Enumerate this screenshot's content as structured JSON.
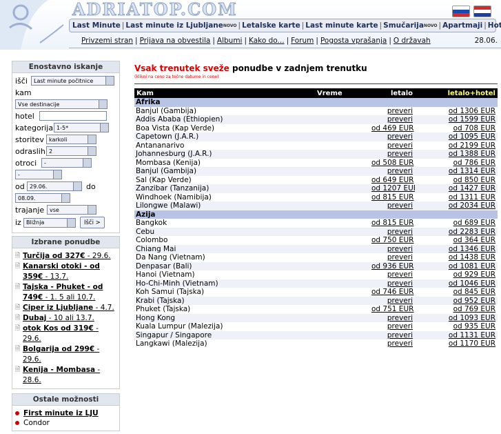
{
  "logo": "ADRIATOP.COM",
  "nav_primary": [
    {
      "label": "Last Minute",
      "sup": ""
    },
    {
      "label": "Last minute iz Ljubljane",
      "sup": "NOVO"
    },
    {
      "label": "Letalske karte",
      "sup": ""
    },
    {
      "label": "Last minute karte",
      "sup": ""
    },
    {
      "label": "Smučarija",
      "sup": "NOVO"
    },
    {
      "label": "Apartmaji",
      "sup": ""
    },
    {
      "label": "Hoteli",
      "sup": ""
    }
  ],
  "nav_secondary": [
    "Privzemi stran",
    "Prijava na obvestila",
    "Albumi",
    "Kako do...",
    "Forum",
    "Pogosta vprašanja",
    "O državah"
  ],
  "date": "28.06.",
  "search": {
    "title": "Enostavno iskanje",
    "isci_label": "išči",
    "isci_value": "Last minute počitnice",
    "kam_label": "kam",
    "kam_value": "Vse destinacije",
    "hotel_label": "hotel",
    "kategorija_label": "kategorija",
    "kategorija_value": "1-5*",
    "storitev_label": "storitev",
    "storitev_value": "karkoli",
    "odraslih_label": "odraslih",
    "odraslih_value": "2",
    "otroci_label": "otroci",
    "otroci_value": "-",
    "extra_value": "-",
    "od_label": "od",
    "od_value": "29.06.",
    "do_label": "do",
    "do_value": "08.09.",
    "trajanje_label": "trajanje",
    "trajanje_value": "vse",
    "iz_label": "iz",
    "iz_value": "Bližnja",
    "button": "Išči >"
  },
  "featured": {
    "title": "Izbrane ponudbe",
    "items": [
      {
        "bold": "Turčija od 327€",
        "rest": " - 29.6."
      },
      {
        "bold": "Kanarski otoki - od 359€",
        "rest": " - 13.7."
      },
      {
        "bold": "Tajska - Phuket - od 749€",
        "rest": " - 1. 5 ali 10.7."
      },
      {
        "bold": "Ciper iz Ljubljane",
        "rest": " - 4.7."
      },
      {
        "bold": "Dubaj",
        "rest": " - 10 ali 13.7."
      },
      {
        "bold": "otok Kos od 319€",
        "rest": " - 29.6."
      },
      {
        "bold": "Bolgarija od 299€",
        "rest": " - 29.6."
      },
      {
        "bold": "Kenija - Mombasa",
        "rest": " - 28.6."
      }
    ]
  },
  "other": {
    "title": "Ostale možnosti",
    "items": [
      {
        "label": "First minute iz LJU",
        "bold": true
      },
      {
        "label": "Condor",
        "bold": false
      }
    ]
  },
  "main": {
    "title_red": "Vsak trenutek sveže",
    "title_rest": " ponudbe v zadnjem trenutku",
    "subtitle": "(klikni na ceno za točne datume in cene)",
    "columns": [
      "Kam",
      "Vreme",
      "letalo",
      "letalo+hotel"
    ],
    "groups": [
      {
        "name": "Afrika",
        "rows": [
          {
            "kam": "Banjul (Gambija)",
            "letalo": "preveri",
            "hotel": "od 1306 EUR"
          },
          {
            "kam": "Addis Ababa (Ethiopien)",
            "letalo": "preveri",
            "hotel": "od 1599 EUR"
          },
          {
            "kam": "Boa Vista (Kap Verde)",
            "letalo": "od 469 EUR",
            "hotel": "od 708 EUR"
          },
          {
            "kam": "Capetown (J.A.R.)",
            "letalo": "preveri",
            "hotel": "od 1095 EUR"
          },
          {
            "kam": "Antananarivo",
            "letalo": "preveri",
            "hotel": "od 2199 EUR"
          },
          {
            "kam": "Johannesburg (J.A.R.)",
            "letalo": "preveri",
            "hotel": "od 1388 EUR"
          },
          {
            "kam": "Mombasa (Kenija)",
            "letalo": "od 508 EUR",
            "hotel": "od 786 EUR"
          },
          {
            "kam": "Banjul (Gambija)",
            "letalo": "preveri",
            "hotel": "od 1314 EUR"
          },
          {
            "kam": "Sal (Kap Verde)",
            "letalo": "od 649 EUR",
            "hotel": "od 850 EUR"
          },
          {
            "kam": "Zanzibar (Tanzanija)",
            "letalo": "od 1207 EUR",
            "hotel": "od 1427 EUR"
          },
          {
            "kam": "Windhoek (Namibija)",
            "letalo": "od 815 EUR",
            "hotel": "od 1311 EUR"
          },
          {
            "kam": "Lilongwe (Malawi)",
            "letalo": "preveri",
            "hotel": "od 2034 EUR"
          }
        ]
      },
      {
        "name": "Azija",
        "rows": [
          {
            "kam": "Bangkok",
            "letalo": "od 815 EUR",
            "hotel": "od 689 EUR"
          },
          {
            "kam": "Cebu",
            "letalo": "preveri",
            "hotel": "od 2283 EUR"
          },
          {
            "kam": "Colombo",
            "letalo": "od 750 EUR",
            "hotel": "od 364 EUR"
          },
          {
            "kam": "Chiang Mai",
            "letalo": "preveri",
            "hotel": "od 1346 EUR"
          },
          {
            "kam": "Da Nang (Vietnam)",
            "letalo": "preveri",
            "hotel": "od 1438 EUR"
          },
          {
            "kam": "Denpasar (Bali)",
            "letalo": "od 936 EUR",
            "hotel": "od 1081 EUR"
          },
          {
            "kam": "Hanoi (Vietnam)",
            "letalo": "preveri",
            "hotel": "od 929 EUR"
          },
          {
            "kam": "Ho-Chi-Minh (Vietnam)",
            "letalo": "preveri",
            "hotel": "od 1046 EUR"
          },
          {
            "kam": "Koh Samui (Tajska)",
            "letalo": "od 746 EUR",
            "hotel": "od 845 EUR"
          },
          {
            "kam": "Krabi (Tajska)",
            "letalo": "preveri",
            "hotel": "od 952 EUR"
          },
          {
            "kam": "Phuket (Tajska)",
            "letalo": "od 751 EUR",
            "hotel": "od 769 EUR"
          },
          {
            "kam": "Hong Kong",
            "letalo": "preveri",
            "hotel": "od 1093 EUR"
          },
          {
            "kam": "Kuala Lumpur (Malezija)",
            "letalo": "preveri",
            "hotel": "od 935 EUR"
          },
          {
            "kam": "Singapur / Singapore",
            "letalo": "preveri",
            "hotel": "od 1131 EUR"
          },
          {
            "kam": "Langkawi (Malezija)",
            "letalo": "preveri",
            "hotel": "od 1170 EUR"
          }
        ]
      }
    ]
  },
  "colors": {
    "header_group": "#b7c4e6",
    "title_red": "#dd0000",
    "hotel_header": "#ffff66"
  }
}
